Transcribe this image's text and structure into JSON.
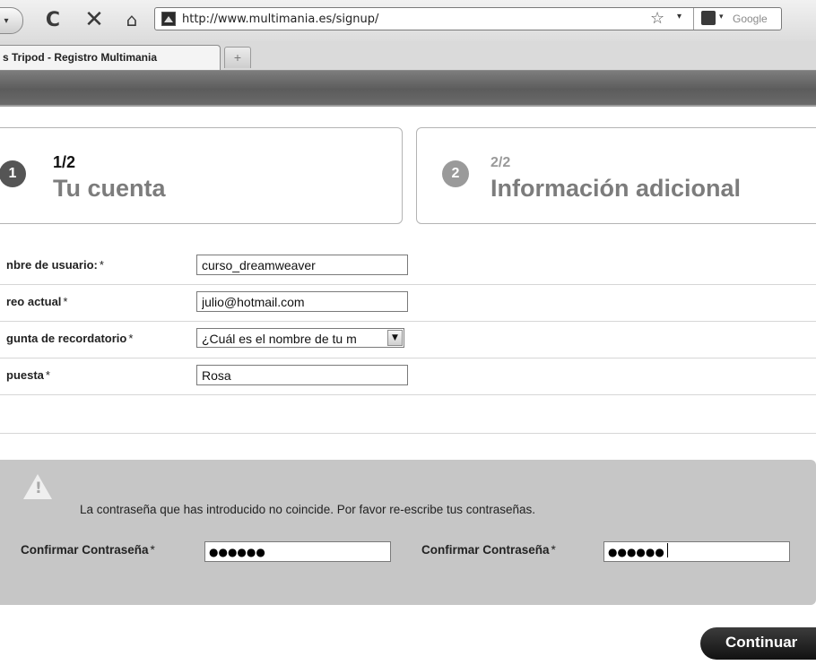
{
  "browser": {
    "url": "http://www.multimania.es/signup/",
    "search_placeholder": "Google",
    "tab_title": "s Tripod - Registro Multimania",
    "new_tab_glyph": "+",
    "icons": {
      "back": "back-dropdown-icon",
      "reload": "reload-icon",
      "stop": "stop-icon",
      "home": "home-icon",
      "bookmark": "star-icon",
      "search_engine": "google-icon"
    }
  },
  "steps": [
    {
      "badge": "1",
      "number": "1/2",
      "title": "Tu cuenta",
      "active": true
    },
    {
      "badge": "2",
      "number": "2/2",
      "title": "Información adicional",
      "active": false
    }
  ],
  "form": {
    "required_mark": "*",
    "username": {
      "label": "nbre de usuario:",
      "value": "curso_dreamweaver"
    },
    "email": {
      "label": "reo actual",
      "value": "julio@hotmail.com"
    },
    "question": {
      "label": "gunta de recordatorio",
      "selected": "¿Cuál es el nombre de tu m"
    },
    "answer": {
      "label": "puesta",
      "value": "Rosa"
    }
  },
  "error_panel": {
    "warning_glyph": "!",
    "message": "La contraseña que has introducido no coincide. Por favor re-escribe tus contraseñas.",
    "confirm_label_1": "Confirmar Contraseña",
    "confirm_label_2": "Confirmar Contraseña",
    "password_mask": "●●●●●●"
  },
  "continue_label": "Continuar"
}
